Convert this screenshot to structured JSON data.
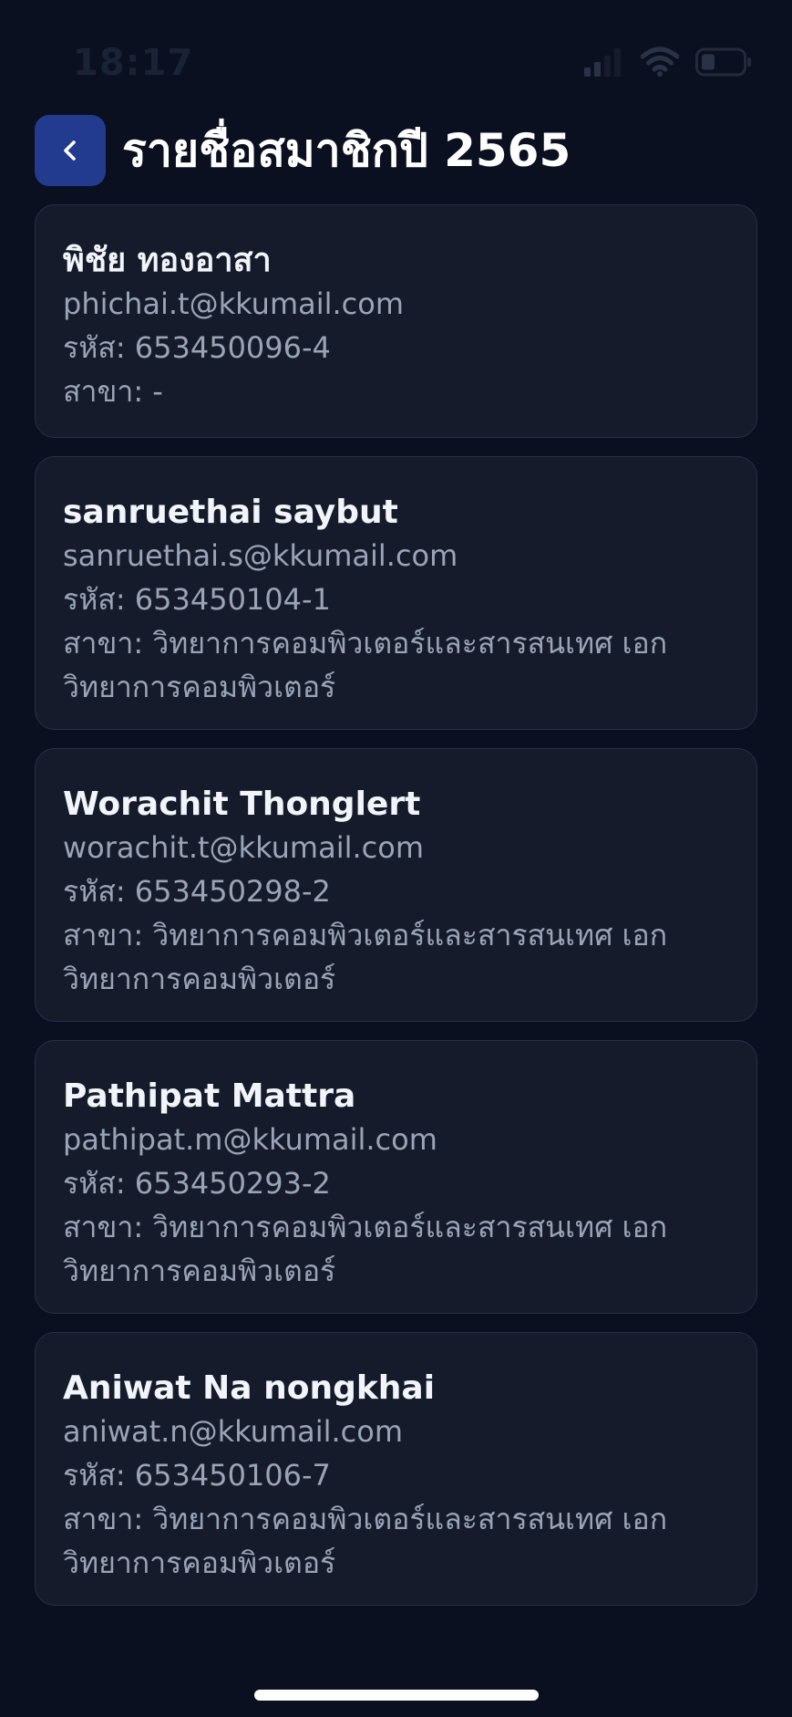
{
  "status_bar": {
    "time": "18:17"
  },
  "header": {
    "title": "รายชื่อสมาชิกปี 2565",
    "back_icon": "chevron-left-icon"
  },
  "labels": {
    "id_prefix": "รหัส:",
    "major_prefix": "สาขา:"
  },
  "members": [
    {
      "name": "พิชัย ทองอาสา",
      "email": "phichai.t@kkumail.com",
      "id": "653450096-4",
      "major": "-"
    },
    {
      "name": "sanruethai saybut",
      "email": "sanruethai.s@kkumail.com",
      "id": "653450104-1",
      "major": "วิทยาการคอมพิวเตอร์และสารสนเทศ เอกวิทยาการคอมพิวเตอร์"
    },
    {
      "name": "Worachit Thonglert",
      "email": "worachit.t@kkumail.com",
      "id": "653450298-2",
      "major": "วิทยาการคอมพิวเตอร์และสารสนเทศ เอกวิทยาการคอมพิวเตอร์"
    },
    {
      "name": "Pathipat Mattra",
      "email": "pathipat.m@kkumail.com",
      "id": "653450293-2",
      "major": "วิทยาการคอมพิวเตอร์และสารสนเทศ เอกวิทยาการคอมพิวเตอร์"
    },
    {
      "name": "Aniwat Na nongkhai",
      "email": "aniwat.n@kkumail.com",
      "id": "653450106-7",
      "major": "วิทยาการคอมพิวเตอร์และสารสนเทศ เอกวิทยาการคอมพิวเตอร์"
    }
  ],
  "colors": {
    "background": "#0b1020",
    "card": "#151b2b",
    "accent": "#233b8f"
  }
}
